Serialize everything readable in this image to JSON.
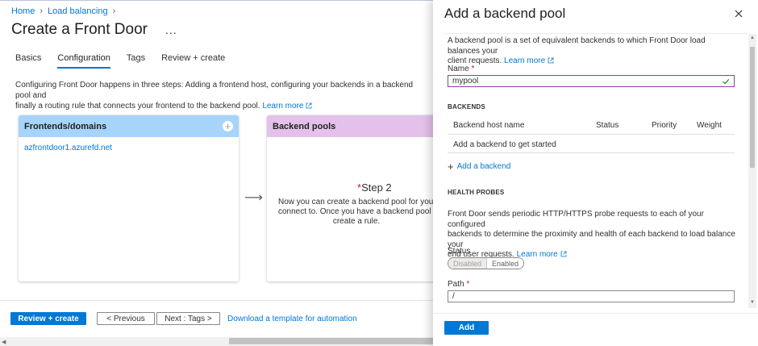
{
  "breadcrumb": [
    "Home",
    "Load balancing"
  ],
  "page_title": "Create a Front Door",
  "more_label": "...",
  "tabs": [
    {
      "label": "Basics",
      "active": false
    },
    {
      "label": "Configuration",
      "active": true
    },
    {
      "label": "Tags",
      "active": false
    },
    {
      "label": "Review + create",
      "active": false
    }
  ],
  "intro": {
    "line1": "Configuring Front Door happens in three steps: Adding a frontend host, configuring your backends in a backend pool and",
    "line2": "finally a routing rule that connects your frontend to the backend pool.",
    "learn_more": "Learn more"
  },
  "frontend_card": {
    "title": "Frontends/domains",
    "host": "azfrontdoor1.azurefd.net",
    "color": "#a6d4fa"
  },
  "backend_card": {
    "title": "Backend pools",
    "step_marker": "*",
    "step": "Step 2",
    "desc_line1": "Now you can create a backend pool for your fron",
    "desc_line2": "connect to. Once you have a backend pool you w",
    "desc_line3": "create a rule.",
    "color": "#e4c1ea"
  },
  "footer": {
    "review_label": "Review + create",
    "previous_label": "< Previous",
    "next_label": "Next : Tags >",
    "download_link": "Download a template for automation"
  },
  "panel": {
    "title": "Add a backend pool",
    "desc_line1": "A backend pool is a set of equivalent backends to which Front Door load balances your",
    "desc_line2": "client requests.",
    "learn_more": "Learn more",
    "name_label": "Name",
    "required_marker": "*",
    "name_value": "mypool",
    "backends_header": "BACKENDS",
    "columns": [
      "Backend host name",
      "Status",
      "Priority",
      "Weight"
    ],
    "empty_row": "Add a backend to get started",
    "add_backend": "Add a backend",
    "health_header": "HEALTH PROBES",
    "health_line1": "Front Door sends periodic HTTP/HTTPS probe requests to each of your configured",
    "health_line2": "backends to determine the proximity and health of each backend to load balance your",
    "health_line3": "end user requests.",
    "status_label": "Status",
    "status_options": [
      "Disabled",
      "Enabled"
    ],
    "status_selected": "Enabled",
    "path_label": "Path",
    "path_value": "/",
    "add_label": "Add"
  },
  "colors": {
    "accent": "#0078d4",
    "input_focus": "#8b3fa5",
    "valid_check": "#107c10",
    "required": "#a4262c"
  }
}
